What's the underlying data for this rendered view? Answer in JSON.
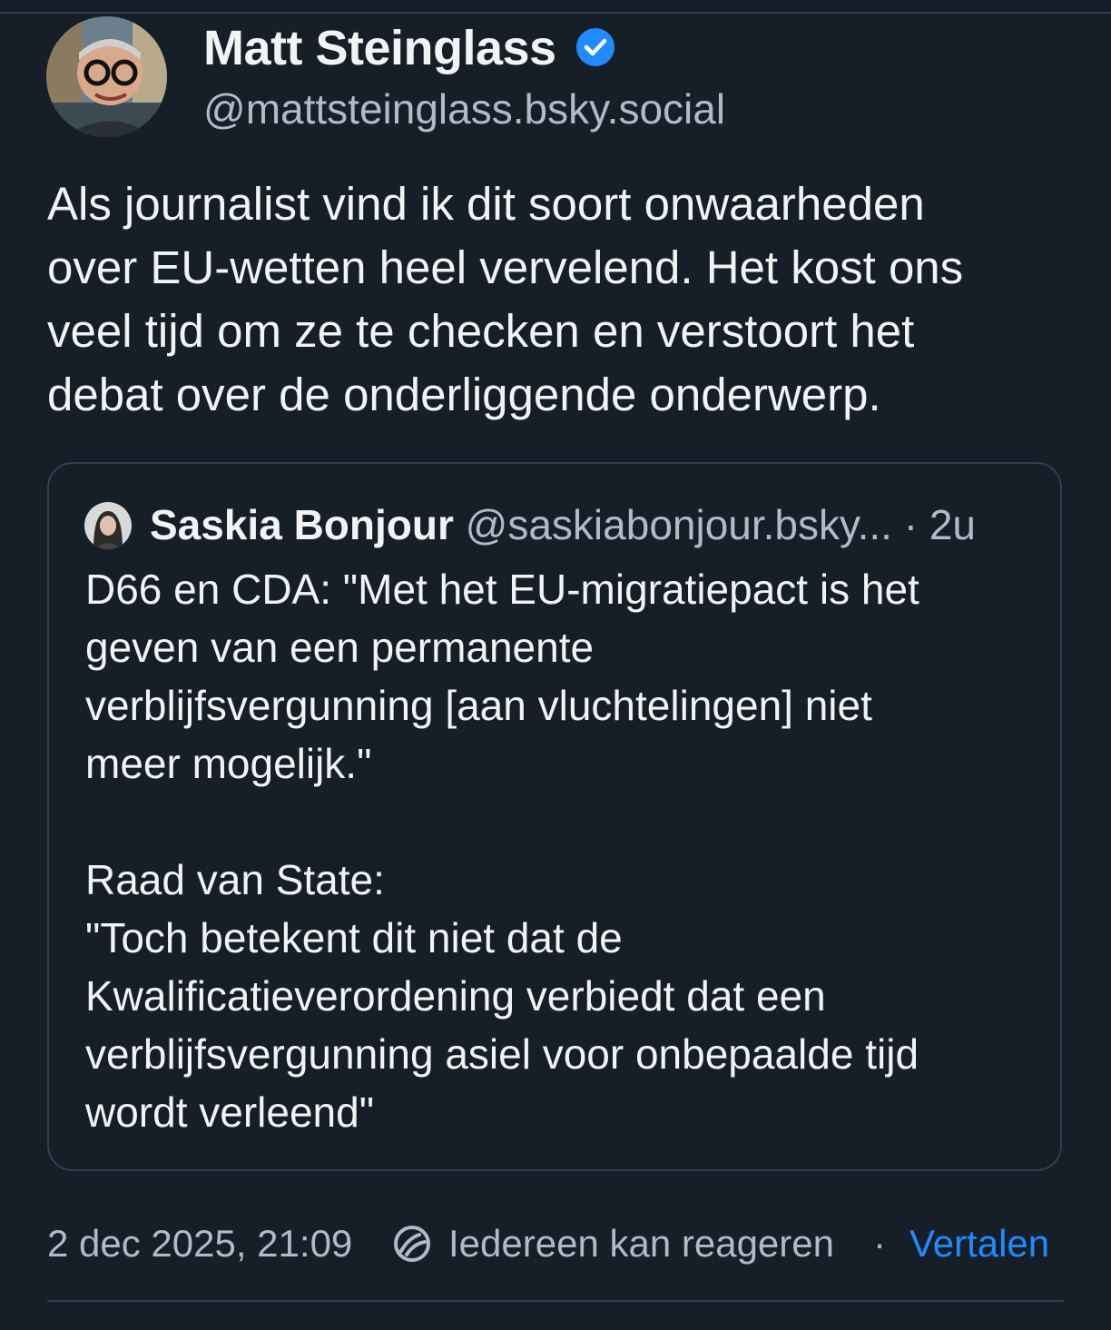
{
  "post": {
    "author_name": "Matt Steinglass",
    "author_handle": "@mattsteinglass.bsky.social",
    "text": "Als journalist vind ik dit soort onwaarheden\nover EU-wetten heel vervelend. Het kost ons\nveel tijd om ze te checken en verstoort het\ndebat over de onderliggende onderwerp.",
    "timestamp": "2 dec 2025, 21:09",
    "reply_setting": "Iedereen kan reageren",
    "separator": "·",
    "translate_label": "Vertalen"
  },
  "quote": {
    "author_name": "Saskia Bonjour",
    "author_handle": "@saskiabonjour.bsky...",
    "separator": " · ",
    "time": "2u",
    "text": "D66 en CDA: \"Met het EU-migratiepact is het\ngeven van een permanente\nverblijfsvergunning [aan vluchtelingen] niet\nmeer mogelijk.\"\n\nRaad van State:\n\"Toch betekent dit niet dat de\nKwalificatieverordening verbiedt dat een\nverblijfsvergunning asiel voor onbepaalde tijd\nwordt verleend\""
  },
  "colors": {
    "background": "#161e27",
    "text": "#f1f3f5",
    "muted": "#aebbc9",
    "accent": "#1f8bff",
    "border": "#2e4052"
  },
  "icons": {
    "verified": "verified-badge-icon",
    "reply": "reply-settings-icon"
  }
}
